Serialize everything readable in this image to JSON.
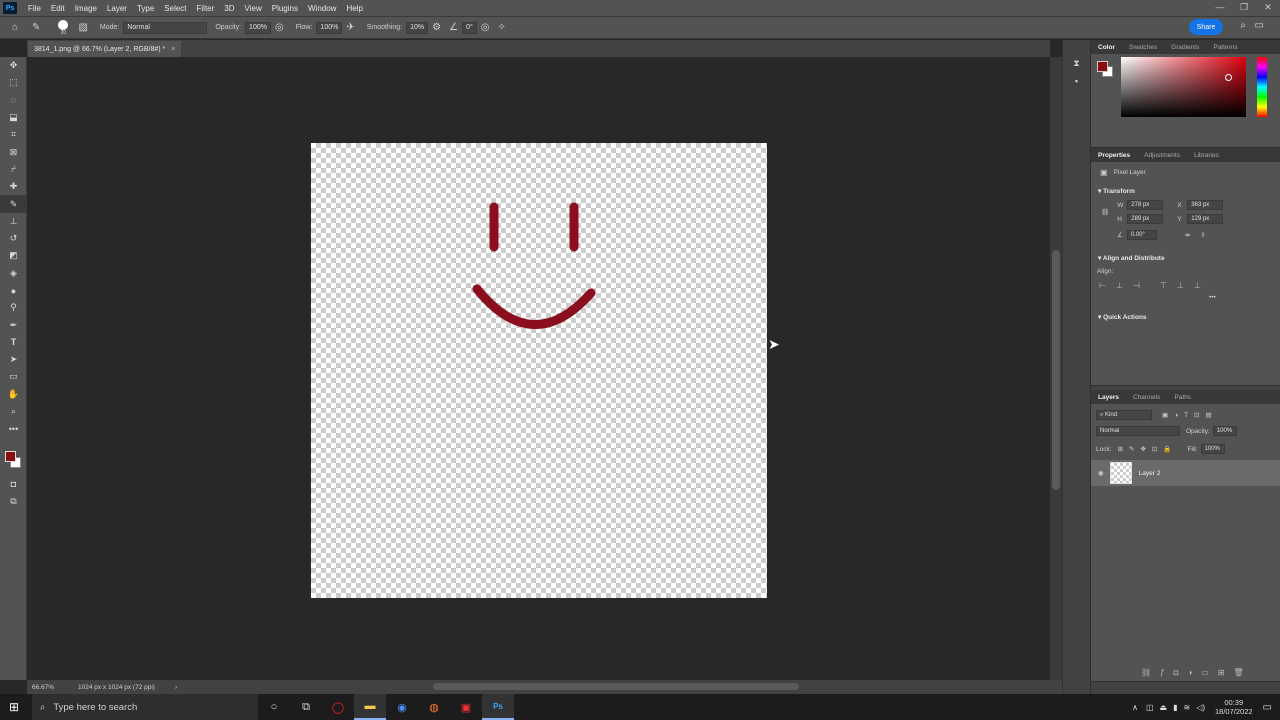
{
  "menu": [
    "File",
    "Edit",
    "Image",
    "Layer",
    "Type",
    "Select",
    "Filter",
    "3D",
    "View",
    "Plugins",
    "Window",
    "Help"
  ],
  "app_logo": "Ps",
  "window_controls": [
    "—",
    "❐",
    "✕"
  ],
  "options": {
    "brush_size": "20",
    "mode_label": "Mode:",
    "mode_value": "Normal",
    "opacity_label": "Opacity:",
    "opacity_value": "100%",
    "flow_label": "Flow:",
    "flow_value": "100%",
    "smoothing_label": "Smoothing:",
    "smoothing_value": "10%",
    "angle_value": "0°",
    "share_label": "Share"
  },
  "document": {
    "tab_title": "3814_1.png @ 66.7% (Layer 2, RGB/8#) *",
    "close_glyph": "×",
    "stroke_color": "#8b0e1e"
  },
  "status": {
    "zoom": "66.67%",
    "doc_size": "1024 px x 1024 px (72 ppi)",
    "arrow": "›"
  },
  "color_panel": {
    "tabs": [
      "Color",
      "Swatches",
      "Gradients",
      "Patterns"
    ],
    "foreground": "#8b0e0e",
    "background": "#ffffff"
  },
  "properties_panel": {
    "tabs": [
      "Properties",
      "Adjustments",
      "Libraries"
    ],
    "layer_type": "Pixel Layer",
    "transform_title": "Transform",
    "w_label": "W",
    "w_value": "278 px",
    "h_label": "H",
    "h_value": "289 px",
    "x_label": "X",
    "x_value": "363 px",
    "y_label": "Y",
    "y_value": "129 px",
    "angle_value": "0.00°",
    "align_title": "Align and Distribute",
    "align_label": "Align:",
    "quick_actions_title": "Quick Actions",
    "more": "•••"
  },
  "layers_panel": {
    "tabs": [
      "Layers",
      "Channels",
      "Paths"
    ],
    "filter_label": "Kind",
    "blend_mode": "Normal",
    "opacity_label": "Opacity:",
    "opacity_value": "100%",
    "lock_label": "Lock:",
    "fill_label": "Fill:",
    "fill_value": "100%",
    "layers": [
      {
        "name": "Layer 2"
      }
    ]
  },
  "taskbar": {
    "search_placeholder": "Type here to search",
    "time": "00:39",
    "date": "18/07/2022"
  }
}
